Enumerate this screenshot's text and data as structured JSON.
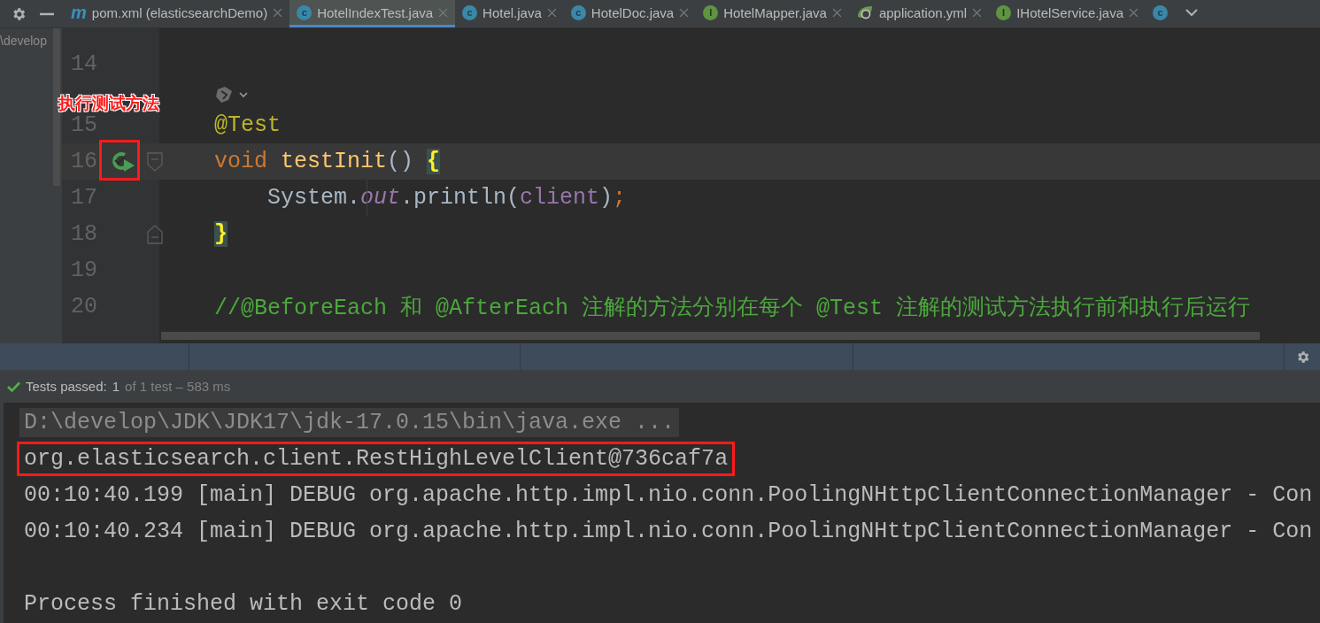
{
  "tabs": [
    {
      "label": "pom.xml (elasticsearchDemo)",
      "kind": "maven",
      "icon_letter": "m",
      "selected": false
    },
    {
      "label": "HotelIndexTest.java",
      "kind": "class",
      "icon_letter": "c",
      "selected": true
    },
    {
      "label": "Hotel.java",
      "kind": "class",
      "icon_letter": "c",
      "selected": false
    },
    {
      "label": "HotelDoc.java",
      "kind": "class",
      "icon_letter": "c",
      "selected": false
    },
    {
      "label": "HotelMapper.java",
      "kind": "interface",
      "icon_letter": "I",
      "selected": false
    },
    {
      "label": "application.yml",
      "kind": "spring",
      "selected": false
    },
    {
      "label": "IHotelService.java",
      "kind": "interface",
      "icon_letter": "I",
      "selected": false
    },
    {
      "kind": "class",
      "icon_letter": "c",
      "selected": false
    }
  ],
  "project_path": "\\develop",
  "editor": {
    "rows": [
      {
        "kind": "cut"
      },
      {
        "kind": "code",
        "number": "14",
        "tokens": []
      },
      {
        "kind": "inlay"
      },
      {
        "kind": "code",
        "number": "15",
        "tokens": [
          {
            "kind": "annotation",
            "text": "@Test"
          }
        ]
      },
      {
        "kind": "code",
        "number": "16",
        "current": true,
        "run_icon": true,
        "fold_open": true,
        "tokens": [
          {
            "kind": "keyword",
            "text": "void "
          },
          {
            "kind": "method",
            "text": "testInit"
          },
          {
            "kind": "plain",
            "text": "() "
          },
          {
            "kind": "brace",
            "text": "{"
          }
        ]
      },
      {
        "kind": "code",
        "number": "17",
        "guide": true,
        "tokens": [
          {
            "kind": "plain",
            "text": "    System."
          },
          {
            "kind": "static",
            "text": "out"
          },
          {
            "kind": "plain",
            "text": ".println("
          },
          {
            "kind": "field",
            "text": "client"
          },
          {
            "kind": "plain",
            "text": ")"
          },
          {
            "kind": "keyword",
            "text": ";"
          }
        ]
      },
      {
        "kind": "code",
        "number": "18",
        "fold_close": true,
        "tokens": [
          {
            "kind": "brace",
            "text": "}"
          }
        ]
      },
      {
        "kind": "code",
        "number": "19",
        "tokens": []
      },
      {
        "kind": "code",
        "number": "20",
        "tokens": [
          {
            "kind": "comment",
            "text": "//@BeforeEach 和 @AfterEach 注解的方法分别在每个 @Test 注解的测试方法执行前和执行后运行"
          }
        ]
      }
    ]
  },
  "callout": {
    "label": "执行测试方法"
  },
  "test_status": {
    "label": "Tests passed:",
    "count": "1",
    "detail": "of 1 test – 583 ms"
  },
  "console": [
    {
      "kind": "command",
      "text": "D:\\develop\\JDK\\JDK17\\jdk-17.0.15\\bin\\java.exe ..."
    },
    {
      "kind": "output",
      "text": "org.elasticsearch.client.RestHighLevelClient@736caf7a",
      "boxed": true
    },
    {
      "kind": "output",
      "text": "00:10:40.199 [main] DEBUG org.apache.http.impl.nio.conn.PoolingNHttpClientConnectionManager - Con"
    },
    {
      "kind": "output",
      "text": "00:10:40.234 [main] DEBUG org.apache.http.impl.nio.conn.PoolingNHttpClientConnectionManager - Con"
    },
    {
      "kind": "empty"
    },
    {
      "kind": "output",
      "text": "Process finished with exit code 0"
    }
  ]
}
